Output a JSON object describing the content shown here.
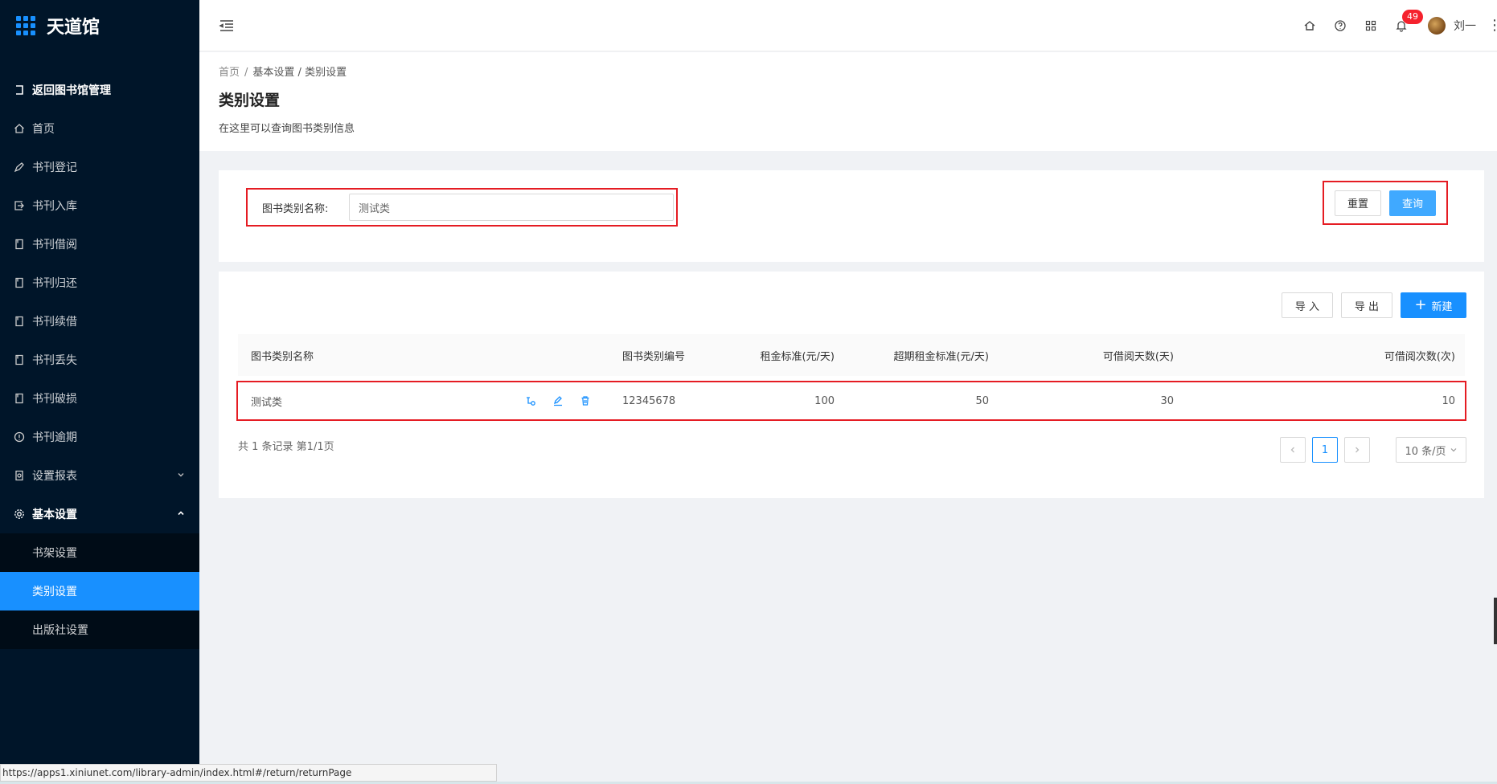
{
  "app": {
    "name": "天道馆"
  },
  "sidebar": {
    "items": [
      {
        "label": "返回图书馆管理",
        "icon": "return-icon",
        "bold": true
      },
      {
        "label": "首页",
        "icon": "home-icon"
      },
      {
        "label": "书刊登记",
        "icon": "pen-icon"
      },
      {
        "label": "书刊入库",
        "icon": "import-icon"
      },
      {
        "label": "书刊借阅",
        "icon": "book-icon"
      },
      {
        "label": "书刊归还",
        "icon": "book-icon"
      },
      {
        "label": "书刊续借",
        "icon": "book-icon"
      },
      {
        "label": "书刊丢失",
        "icon": "book-icon"
      },
      {
        "label": "书刊破损",
        "icon": "book-icon"
      },
      {
        "label": "书刊逾期",
        "icon": "info-circle-icon"
      },
      {
        "label": "设置报表",
        "icon": "report-icon",
        "arrow": "chevron-down-icon"
      },
      {
        "label": "基本设置",
        "icon": "gear-icon",
        "arrow": "chevron-up-icon",
        "bold": true
      }
    ],
    "submenu": [
      {
        "label": "书架设置"
      },
      {
        "label": "类别设置",
        "active": true
      },
      {
        "label": "出版社设置"
      }
    ]
  },
  "header": {
    "notification_count": "49",
    "username": "刘一"
  },
  "breadcrumb": {
    "home": "首页",
    "sep": "/",
    "parent": "基本设置",
    "current": "类别设置"
  },
  "page": {
    "title": "类别设置",
    "description": "在这里可以查询图书类别信息"
  },
  "search": {
    "label": "图书类别名称:",
    "value": "测试类",
    "reset_label": "重置",
    "query_label": "查询"
  },
  "toolbar": {
    "import_label": "导 入",
    "export_label": "导 出",
    "new_label": "新建"
  },
  "table": {
    "columns": [
      "图书类别名称",
      "图书类别编号",
      "租金标准(元/天)",
      "超期租金标准(元/天)",
      "可借阅天数(天)",
      "可借阅次数(次)"
    ],
    "rows": [
      {
        "name": "测试类",
        "code": "12345678",
        "rent": "100",
        "overdue_rent": "50",
        "days": "30",
        "times": "10"
      }
    ]
  },
  "pagination": {
    "summary": "共 1 条记录 第1/1页",
    "current_page": "1",
    "page_size": "10 条/页"
  },
  "statusbar": {
    "url": "https://apps1.xiniunet.com/library-admin/index.html#/return/returnPage"
  },
  "colors": {
    "sidebar_bg": "#001529",
    "active": "#1890ff",
    "highlight_border": "#e51c23"
  }
}
